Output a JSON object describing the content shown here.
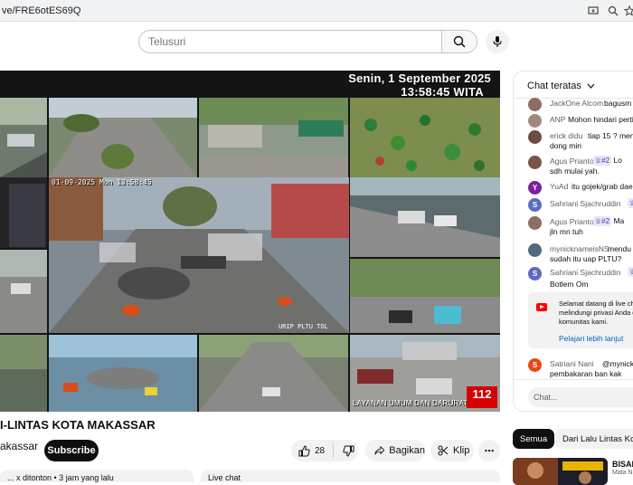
{
  "browser": {
    "url": "ve/FRE6otES69Q"
  },
  "masthead": {
    "search_placeholder": "Telusuri",
    "icons": [
      "search-icon",
      "mic-icon"
    ]
  },
  "player": {
    "overlay_date": "Senin, 1 September 2025",
    "overlay_time": "13:58:45 WITA",
    "cam_timestamp": "01-09-2025 Mon 13:58:45",
    "cam_label": "URIP PLTU TOL",
    "service_text": "LAYANAN UMUM DAN DARURAT",
    "badge": "112"
  },
  "video": {
    "title": "I-LINTAS KOTA MAKASSAR",
    "channel": "akassar",
    "subscribe_label": "Subscribe",
    "likes": "28",
    "share_label": "Bagikan",
    "clip_label": "Klip",
    "more_label": "⋯"
  },
  "chat": {
    "header": "Chat teratas",
    "messages": [
      {
        "author": "JackOne Alcom",
        "text": "bagusm"
      },
      {
        "author": "ANP",
        "text": "Mohon hindari perti"
      },
      {
        "author": "erick didu",
        "text": "tiap 15 ? menit",
        "text2": "dong min"
      },
      {
        "author": "Agus Prianto",
        "badge": "#2",
        "text": "Lo",
        "text2": "sdh mulai yah."
      },
      {
        "author": "YuAd",
        "text": "itu gojek/grab daer"
      },
      {
        "author": "Sahriani Sjachruddin",
        "text": ""
      },
      {
        "author": "Agus Prianto",
        "badge": "#2",
        "text": "Ma",
        "text2": "jln mn tuh"
      },
      {
        "author": "mynicknameisNS",
        "text": "mendu",
        "text2": "sudah itu uap PLTU?"
      },
      {
        "author": "Sahriani Sjachruddin",
        "text": "",
        "text2": "Botlem Om"
      },
      {
        "author": "Satriani Nani",
        "text": "@mynickna",
        "text2": "pembakaran ban kak"
      }
    ],
    "notice_lines": [
      "Selamat datang di live ch",
      "melindungi privasi Anda d",
      "komunitas kami."
    ],
    "notice_link": "Pelajari lebih lanjut",
    "input_placeholder": "Chat..."
  },
  "chips": {
    "all": "Semua",
    "from": "Dari Lalu Lintas Kota"
  },
  "recommendation": {
    "title": "BISAK",
    "subtitle": "Mata N"
  },
  "description_stubs": [
    "... x ditonton • 3 jam yang lalu",
    "Live chat"
  ],
  "colors": {
    "youtube_red": "#ff0000",
    "link_blue": "#065fd4",
    "chip_dark": "#0f0f0f"
  }
}
